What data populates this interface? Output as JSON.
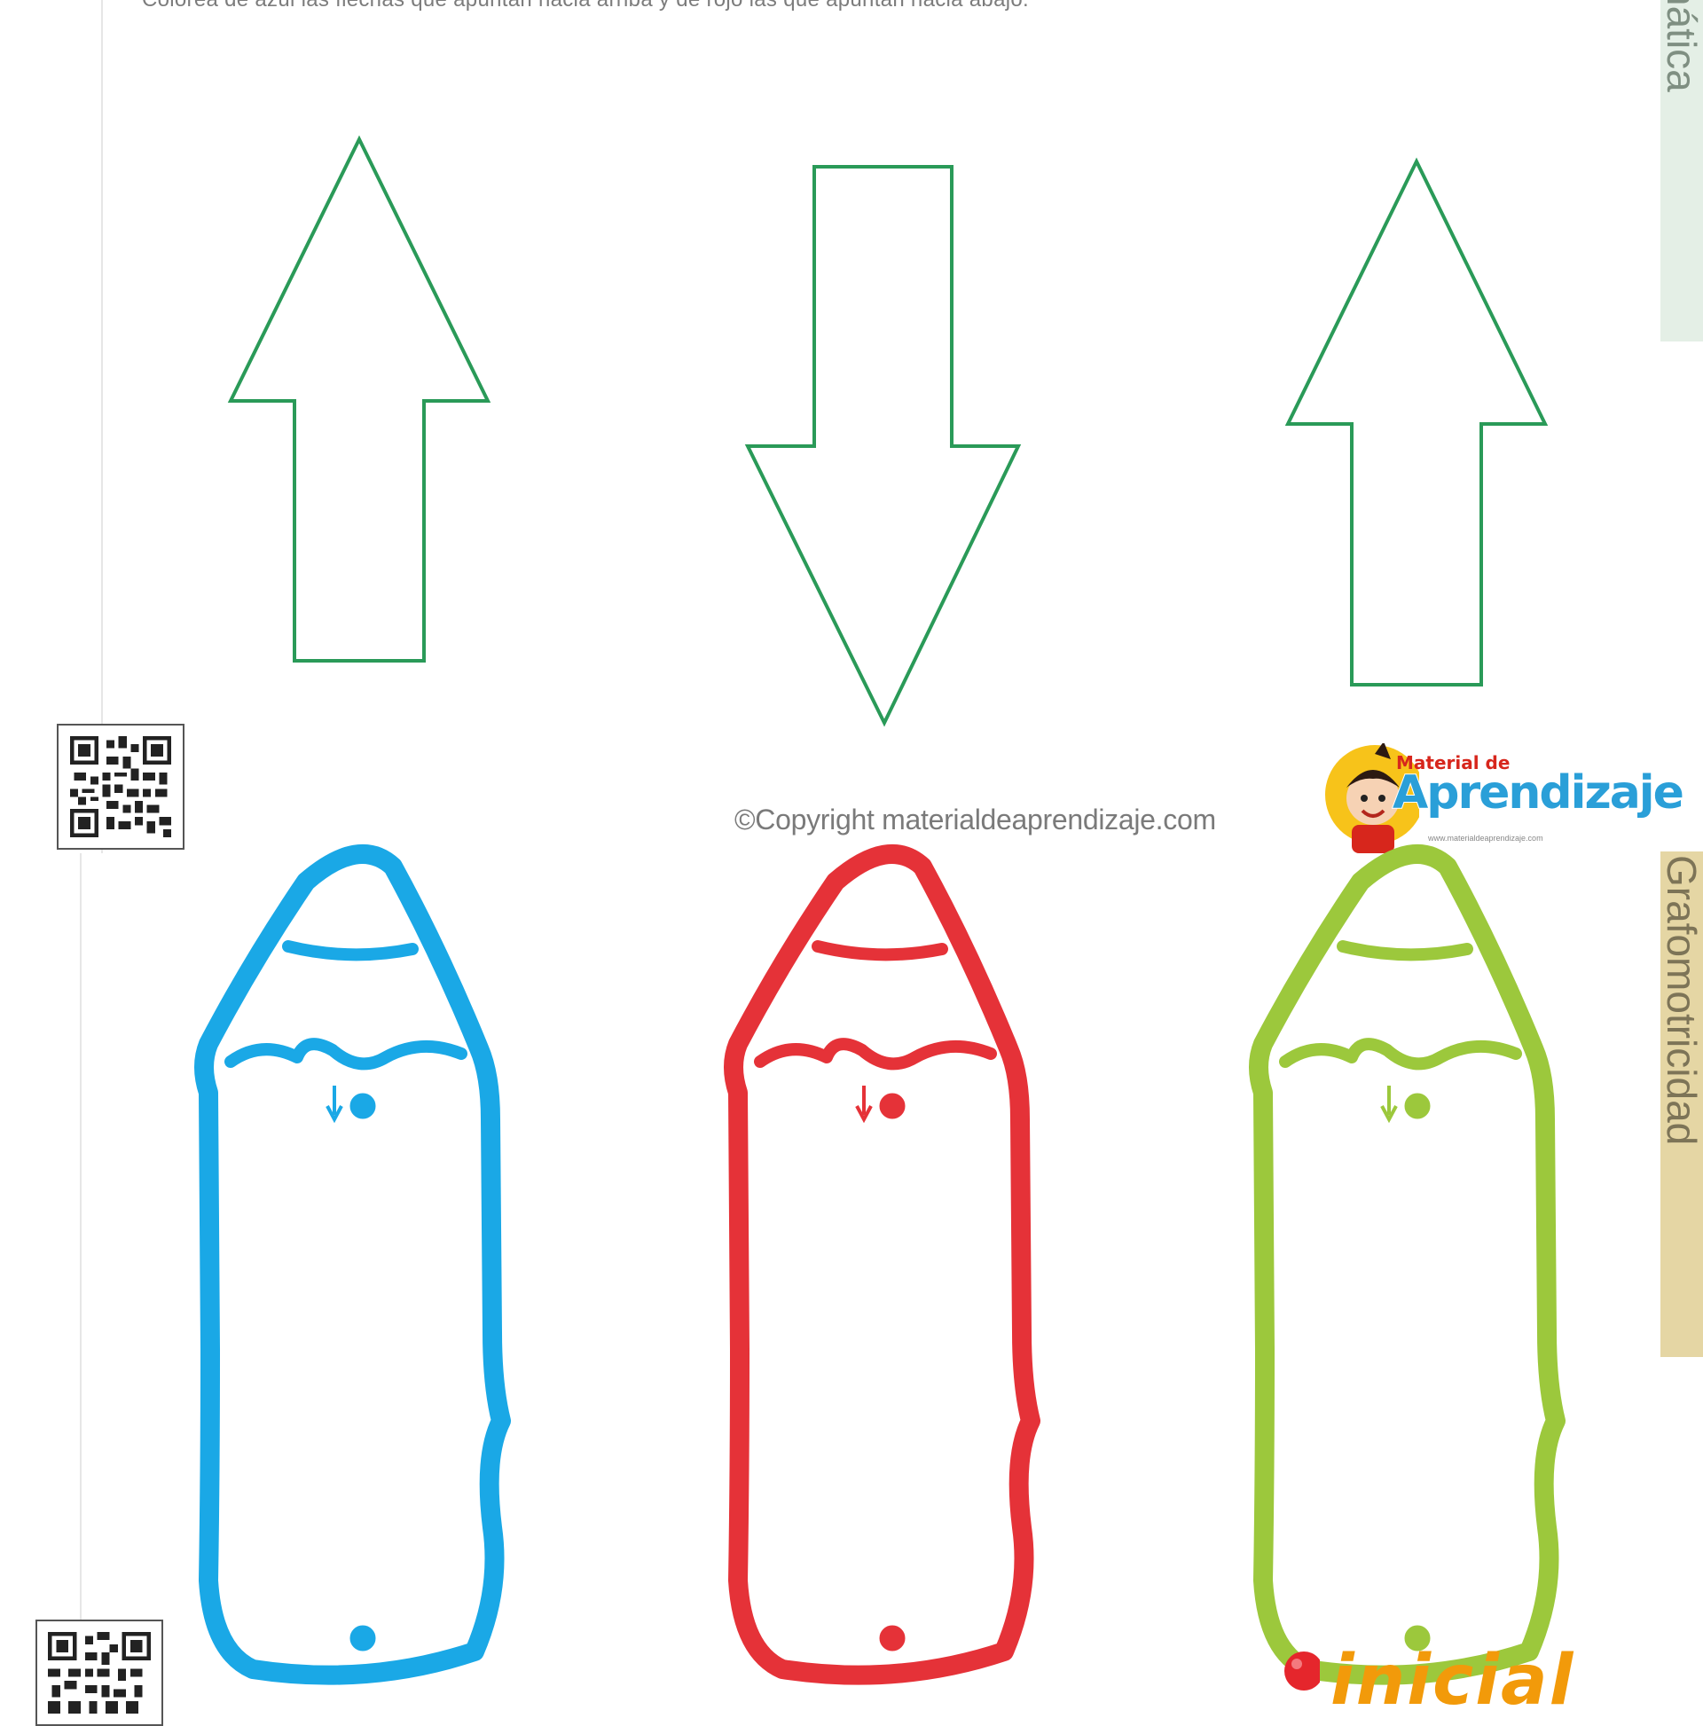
{
  "top_sheet": {
    "instruction": "Colorea de azul las flechas que apuntan hacia arriba y de rojo las que apuntan hacia abajo.",
    "arrows": [
      {
        "direction": "up"
      },
      {
        "direction": "down"
      },
      {
        "direction": "up"
      }
    ],
    "arrow_color": "#2a9a58",
    "copyright": "©Copyright materialdeaprendizaje.com",
    "side_tab": "Matemática",
    "logo": {
      "top_text": "Material de",
      "main_text": "Aprendizaje",
      "url": "www.materialdeaprendizaje.com"
    }
  },
  "bottom_sheet": {
    "side_tab": "Grafomotricidad",
    "pencils": [
      {
        "color": "#1aa8e6"
      },
      {
        "color": "#e53238"
      },
      {
        "color": "#9cc83c"
      }
    ],
    "footer_logo": "inicial"
  }
}
